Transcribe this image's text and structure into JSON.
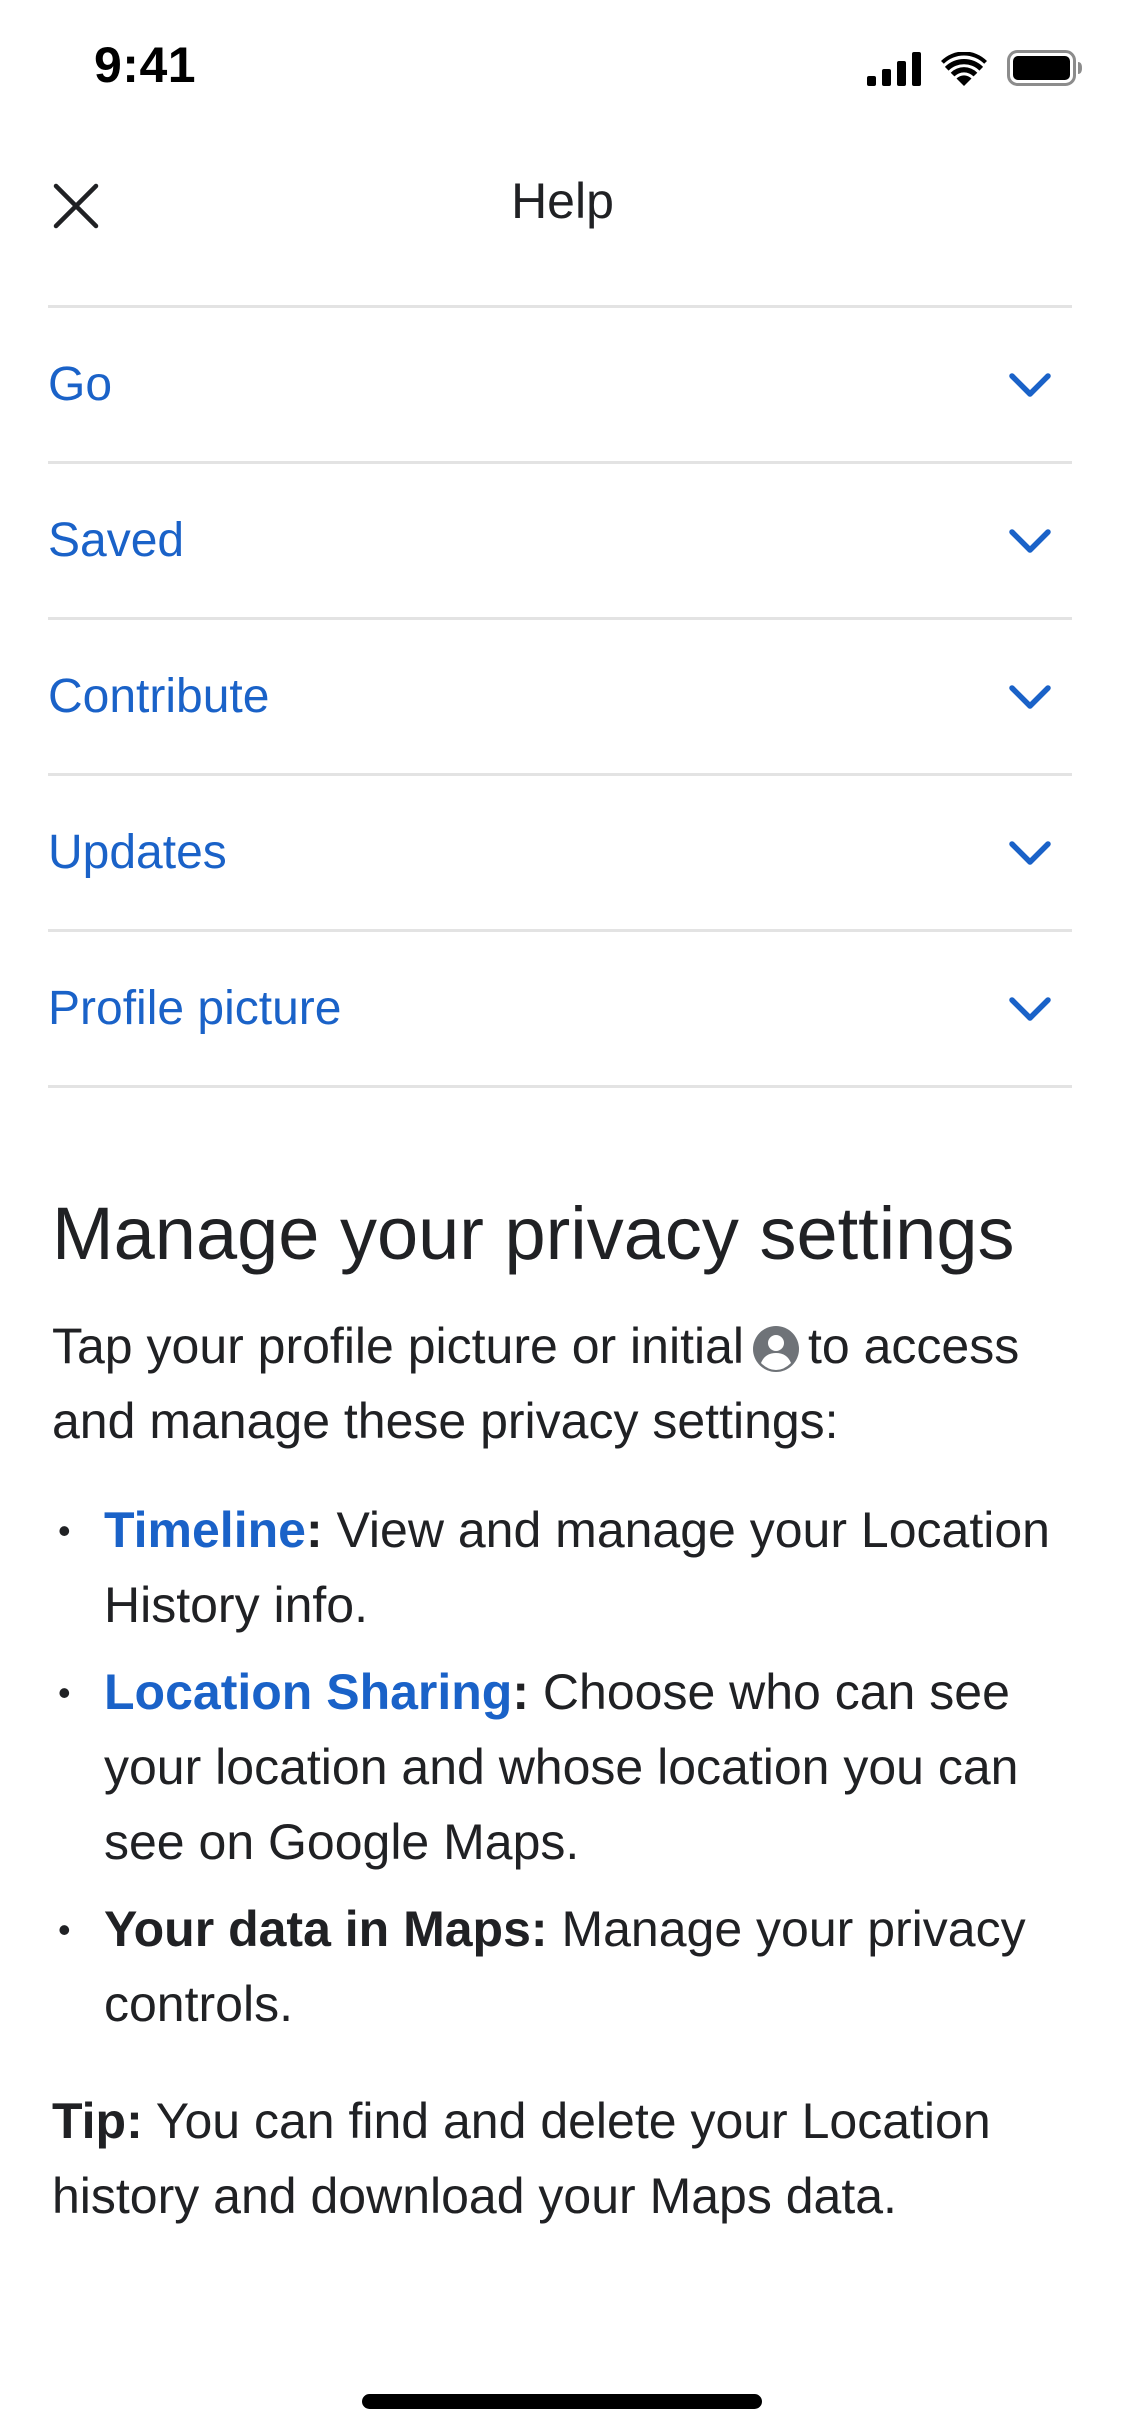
{
  "status_bar": {
    "time": "9:41"
  },
  "header": {
    "title": "Help"
  },
  "accordion": {
    "items": [
      {
        "label": "Go"
      },
      {
        "label": "Saved"
      },
      {
        "label": "Contribute"
      },
      {
        "label": "Updates"
      },
      {
        "label": "Profile picture"
      }
    ]
  },
  "content": {
    "title": "Manage your privacy settings",
    "intro_before": "Tap your profile picture or initial",
    "intro_after": "to access and manage these privacy settings:",
    "bullets": [
      {
        "term": "Timeline",
        "colon": ":",
        "text": " View and manage your Location History info."
      },
      {
        "term": "Location Sharing",
        "colon": ":",
        "text": " Choose who can see your location and whose location you can see on Google Maps."
      },
      {
        "term": "Your data in Maps:",
        "text": " Manage your privacy controls."
      }
    ],
    "tip_label": "Tip:",
    "tip_text": " You can find and delete your Location history and download your Maps data."
  },
  "colors": {
    "link": "#1a62c8",
    "text": "#202124",
    "divider": "#e3e3e3"
  },
  "icons": {
    "close": "close-icon",
    "chevron": "chevron-down-icon",
    "avatar": "account-circle-icon"
  }
}
